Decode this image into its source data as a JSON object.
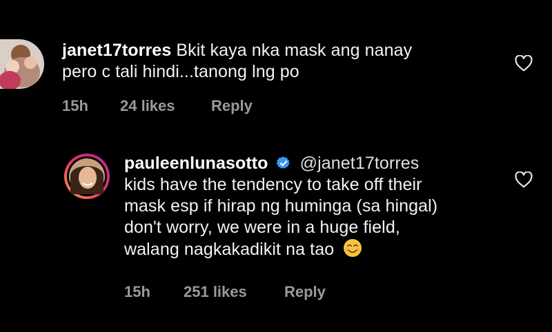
{
  "comments": [
    {
      "username": "janet17torres",
      "lines": [
        "Bkit kaya nka mask ang nanay",
        "pero c tali hindi...tanong lng po"
      ],
      "time": "15h",
      "likes": "24 likes",
      "reply_label": "Reply"
    },
    {
      "username": "pauleenlunasotto",
      "mention": "@janet17torres",
      "lines": [
        "kids have the tendency to take off their",
        "mask esp if hirap ng huminga (sa hingal)",
        "don't worry, we were in a huge field,",
        "walang nagkakadikit na tao"
      ],
      "emoji": "smiling-face-emoji",
      "time": "15h",
      "likes": "251 likes",
      "reply_label": "Reply",
      "verified_color": "#3897f0"
    }
  ],
  "icons": {
    "like": "heart-outline-icon",
    "verified": "verified-badge-icon"
  },
  "colors": {
    "background": "#000000",
    "text": "#f2f2f2",
    "meta": "#9a9a9a",
    "story_ring": "#e1306c"
  }
}
